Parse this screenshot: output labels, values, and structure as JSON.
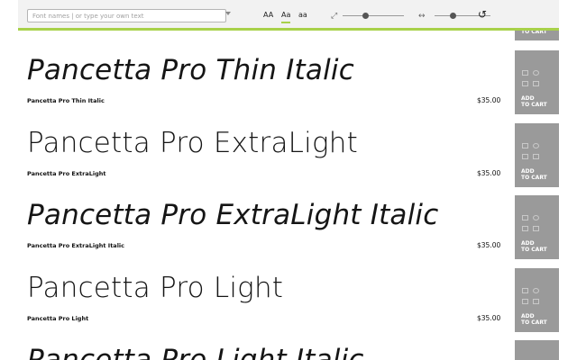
{
  "toolbar": {
    "search_placeholder": "Font names | or type your own text",
    "case_buttons": [
      "AA",
      "Aa",
      "aa"
    ],
    "active_case": "Aa",
    "reset_icon": "reset-icon"
  },
  "top_cart_label": "TO CART",
  "rows": [
    {
      "sample": "Pancetta Pro Thin Italic",
      "name": "Pancetta Pro Thin Italic",
      "price": "$35.00",
      "cart_line1": "ADD",
      "cart_line2": "TO CART"
    },
    {
      "sample": "Pancetta Pro ExtraLight",
      "name": "Pancetta Pro ExtraLight",
      "price": "$35.00",
      "cart_line1": "ADD",
      "cart_line2": "TO CART"
    },
    {
      "sample": "Pancetta Pro ExtraLight Italic",
      "name": "Pancetta Pro ExtraLight Italic",
      "price": "$35.00",
      "cart_line1": "ADD",
      "cart_line2": "TO CART"
    },
    {
      "sample": "Pancetta Pro Light",
      "name": "Pancetta Pro Light",
      "price": "$35.00",
      "cart_line1": "ADD",
      "cart_line2": "TO CART"
    },
    {
      "sample": "Pancetta Pro Light Italic"
    }
  ],
  "colors": {
    "accent": "#a8d14a",
    "cart_bg": "#9a9a9a",
    "toolbar_bg": "#f2f2f2"
  }
}
